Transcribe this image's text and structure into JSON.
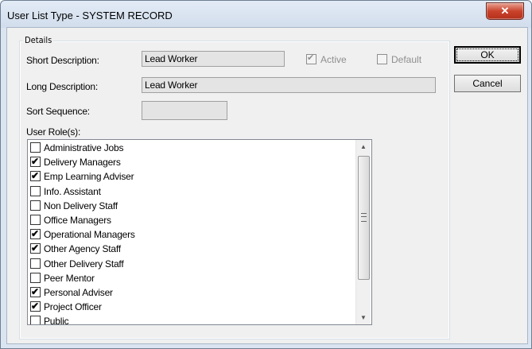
{
  "window": {
    "title": "User List Type - SYSTEM RECORD",
    "close_glyph": "✕"
  },
  "details": {
    "legend": "Details",
    "short_description_label": "Short Description:",
    "short_description_value": "Lead Worker",
    "long_description_label": "Long Description:",
    "long_description_value": "Lead Worker",
    "sort_sequence_label": "Sort Sequence:",
    "sort_sequence_value": "",
    "active_label": "Active",
    "active_checked": true,
    "default_label": "Default",
    "default_checked": false,
    "user_roles_label": "User Role(s):"
  },
  "buttons": {
    "ok": "OK",
    "cancel": "Cancel"
  },
  "roles": [
    {
      "label": "Administrative Jobs",
      "checked": false
    },
    {
      "label": "Delivery Managers",
      "checked": true
    },
    {
      "label": "Emp Learning Adviser",
      "checked": true
    },
    {
      "label": "Info. Assistant",
      "checked": false
    },
    {
      "label": "Non Delivery Staff",
      "checked": false
    },
    {
      "label": "Office Managers",
      "checked": false
    },
    {
      "label": "Operational Managers",
      "checked": true
    },
    {
      "label": "Other Agency Staff",
      "checked": true
    },
    {
      "label": "Other Delivery Staff",
      "checked": false
    },
    {
      "label": "Peer Mentor",
      "checked": false
    },
    {
      "label": "Personal Adviser",
      "checked": true
    },
    {
      "label": "Project Officer",
      "checked": true
    },
    {
      "label": "Public",
      "checked": false
    }
  ]
}
